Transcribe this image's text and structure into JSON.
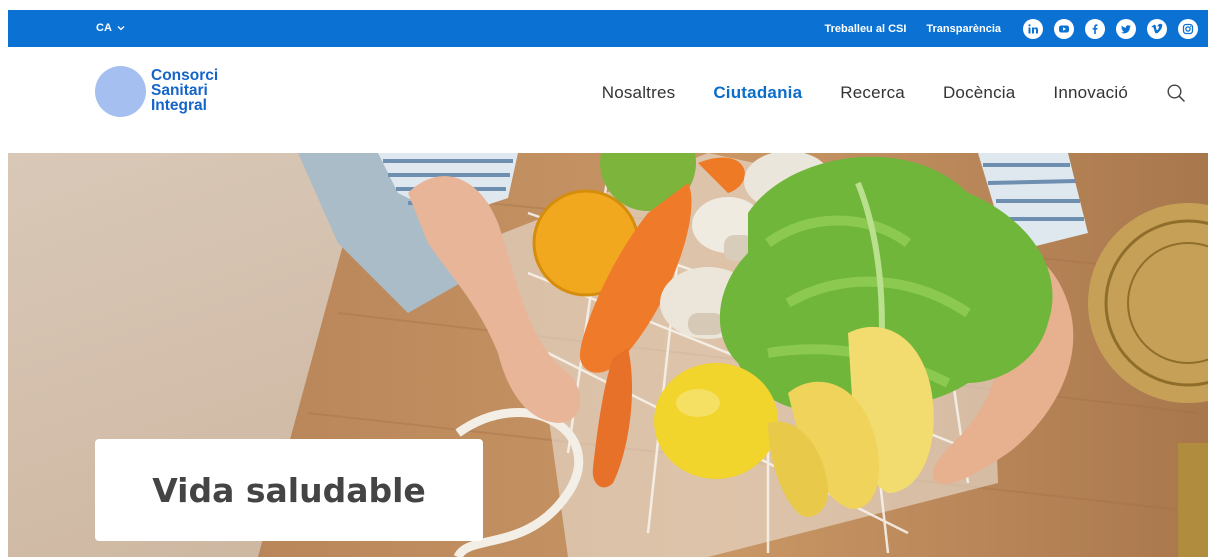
{
  "topbar": {
    "language": "CA",
    "links": [
      "Treballeu al CSI",
      "Transparència"
    ],
    "social_icons": [
      "linkedin-icon",
      "youtube-icon",
      "facebook-icon",
      "twitter-icon",
      "vimeo-icon",
      "instagram-icon"
    ],
    "color": "#0b72d4"
  },
  "header": {
    "logo": {
      "line1": "Consorci",
      "line2": "Sanitari",
      "line3": "Integral"
    },
    "nav": [
      "Nosaltres",
      "Ciutadania",
      "Recerca",
      "Docència",
      "Innovació"
    ],
    "active_nav": "Ciutadania",
    "brand_color": "#1565c9"
  },
  "hero": {
    "title": "Vida saludable"
  }
}
